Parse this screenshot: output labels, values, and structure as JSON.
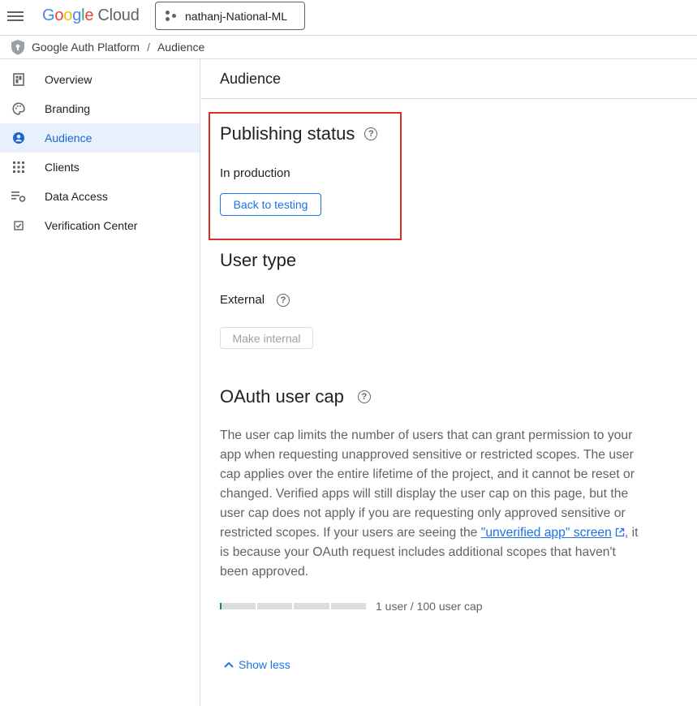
{
  "header": {
    "logo_google": "Google",
    "logo_cloud": "Cloud",
    "project_name": "nathanj-National-ML"
  },
  "breadcrumb": {
    "root": "Google Auth Platform",
    "separator": "/",
    "current": "Audience"
  },
  "sidebar": {
    "items": [
      {
        "label": "Overview",
        "icon": "dashboard-icon"
      },
      {
        "label": "Branding",
        "icon": "palette-icon"
      },
      {
        "label": "Audience",
        "icon": "account-circle-icon",
        "active": true
      },
      {
        "label": "Clients",
        "icon": "apps-grid-icon"
      },
      {
        "label": "Data Access",
        "icon": "list-settings-icon"
      },
      {
        "label": "Verification Center",
        "icon": "checkbox-icon"
      }
    ]
  },
  "main": {
    "page_title": "Audience",
    "publishing_status": {
      "title": "Publishing status",
      "status": "In production",
      "button": "Back to testing"
    },
    "user_type": {
      "title": "User type",
      "value": "External",
      "button": "Make internal"
    },
    "user_cap": {
      "title": "OAuth user cap",
      "paragraph_before": "The user cap limits the number of users that can grant permission to your app when requesting unapproved sensitive or restricted scopes. The user cap applies over the entire lifetime of the project, and it cannot be reset or changed. Verified apps will still display the user cap on this page, but the user cap does not apply if you are requesting only approved sensitive or restricted scopes. If your users are seeing the ",
      "link_text": "\"unverified app\" screen",
      "paragraph_after": ", it is because your OAuth request includes additional scopes that haven't been approved.",
      "cap_label": "1 user / 100 user cap",
      "progress_fraction": 0.01,
      "show_less": "Show less"
    }
  },
  "colors": {
    "accent": "#1a73e8",
    "active_nav_bg": "#e8f0fe",
    "highlight_border": "#d93025",
    "progress_fill": "#1e8e3e"
  }
}
